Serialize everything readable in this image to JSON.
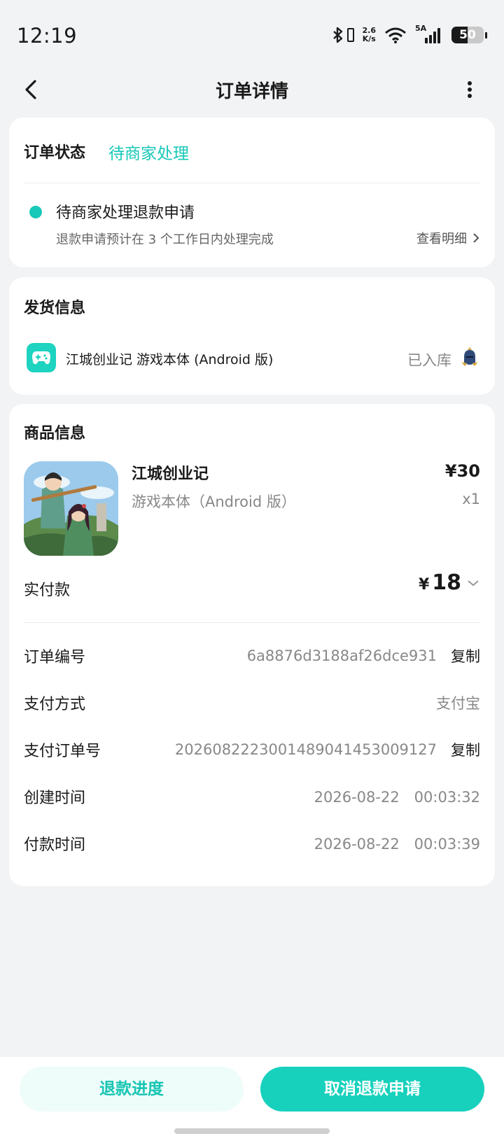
{
  "status_bar": {
    "time": "12:19",
    "net_speed_value": "2.6",
    "net_speed_unit": "K/s",
    "signal_label": "5A",
    "battery": "50",
    "battery_level": 0.5
  },
  "nav": {
    "title": "订单详情"
  },
  "order_status": {
    "label": "订单状态",
    "value": "待商家处理",
    "event_title": "待商家处理退款申请",
    "event_desc": "退款申请预计在 3 个工作日内处理完成",
    "detail_link": "查看明细"
  },
  "shipping": {
    "title": "发货信息",
    "item_name": "江城创业记 游戏本体 (Android 版)",
    "state": "已入库"
  },
  "product": {
    "title": "商品信息",
    "name": "江城创业记",
    "variant": "游戏本体（Android 版）",
    "price": "¥30",
    "quantity": "x1",
    "paid_label": "实付款",
    "paid_currency": "¥",
    "paid_amount": "18"
  },
  "details": [
    {
      "label": "订单编号",
      "value": "6a8876d3188af26dce931",
      "copy": "复制"
    },
    {
      "label": "支付方式",
      "value": "支付宝"
    },
    {
      "label": "支付订单号",
      "value": "2026082223001489041453009127",
      "copy": "复制"
    },
    {
      "label": "创建时间",
      "value": "2026-08-22　00:03:32"
    },
    {
      "label": "付款时间",
      "value": "2026-08-22　00:03:39"
    }
  ],
  "actions": {
    "progress": "退款进度",
    "cancel": "取消退款申请"
  },
  "colors": {
    "accent": "#18c8b8",
    "primary_button": "#17d1bd",
    "background": "#f2f3f5"
  },
  "icons": [
    "back-arrow-icon",
    "more-vertical-icon",
    "bluetooth-icon",
    "wifi-icon",
    "gamepad-icon",
    "chevron-right-icon",
    "chevron-down-icon",
    "knight-helmet-icon"
  ]
}
